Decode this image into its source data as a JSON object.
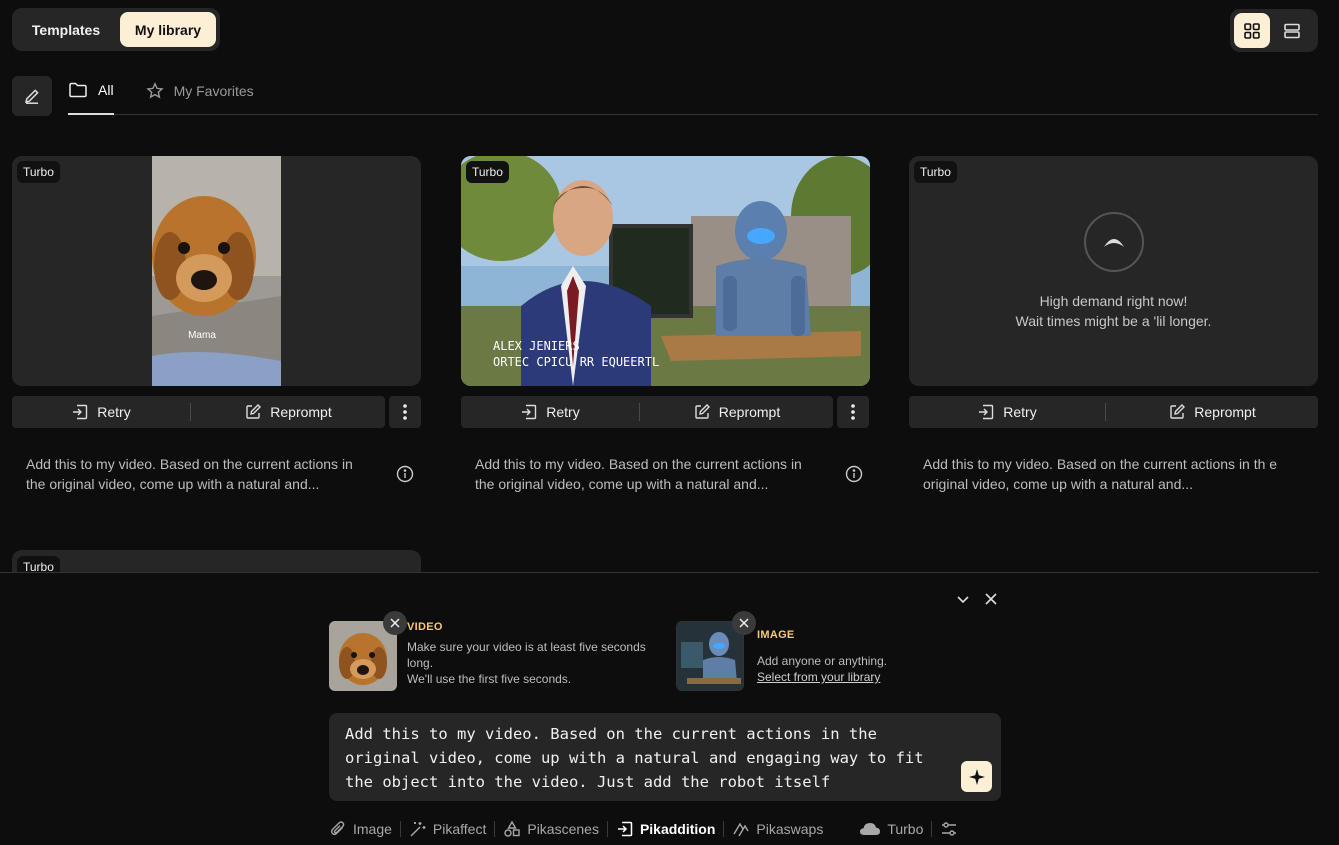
{
  "header": {
    "tabs": [
      {
        "label": "Templates",
        "active": false
      },
      {
        "label": "My library",
        "active": true
      }
    ],
    "view_modes": [
      "grid-icon",
      "list-icon"
    ],
    "active_view": "grid"
  },
  "filters": {
    "tabs": [
      {
        "label": "All",
        "icon": "folder-icon",
        "active": true
      },
      {
        "label": "My Favorites",
        "icon": "star-icon",
        "active": false
      }
    ]
  },
  "cards": [
    {
      "badge": "Turbo",
      "thumb_caption": "Mama",
      "retry_label": "Retry",
      "reprompt_label": "Reprompt",
      "description": "Add this to my video. Based on the current actions in the original video, come up with a natural and..."
    },
    {
      "badge": "Turbo",
      "lower_third_name": "ALEX JENIERS",
      "lower_third_title": "ORTEC CPICU RR EQUEERTL",
      "retry_label": "Retry",
      "reprompt_label": "Reprompt",
      "description": "Add this to my video. Based on the current actions in the original video, come up with a natural and..."
    },
    {
      "badge": "Turbo",
      "status_line1": "High demand right now!",
      "status_line2": "Wait times might be a 'lil longer.",
      "retry_label": "Retry",
      "reprompt_label": "Reprompt",
      "description": "Add this to my video. Based on the current actions in th e original video, come up with a natural and..."
    },
    {
      "badge": "Turbo"
    }
  ],
  "composer": {
    "video": {
      "type_label": "VIDEO",
      "line1": "Make sure your video is at least five seconds long.",
      "line2": "We'll use the first five seconds."
    },
    "image": {
      "type_label": "IMAGE",
      "line1": "Add anyone or anything.",
      "link": "Select from your library"
    },
    "prompt": "Add this to my video. Based on the current actions in the original video, come up with a natural and engaging way to fit the object into the video. Just add the robot itself",
    "tools": [
      {
        "label": "Image",
        "icon": "paperclip-icon",
        "active": false
      },
      {
        "label": "Pikaffect",
        "icon": "magic-wand-icon",
        "active": false
      },
      {
        "label": "Pikascenes",
        "icon": "shapes-icon",
        "active": false
      },
      {
        "label": "Pikaddition",
        "icon": "add-frame-icon",
        "active": true
      },
      {
        "label": "Pikaswaps",
        "icon": "swap-icon",
        "active": false
      },
      {
        "label": "Turbo",
        "icon": "cloud-icon",
        "active": false
      }
    ]
  },
  "colors": {
    "background": "#0d0d0d",
    "surface": "#262626",
    "accent": "#fdeed6",
    "media_label": "#f5c97a"
  }
}
